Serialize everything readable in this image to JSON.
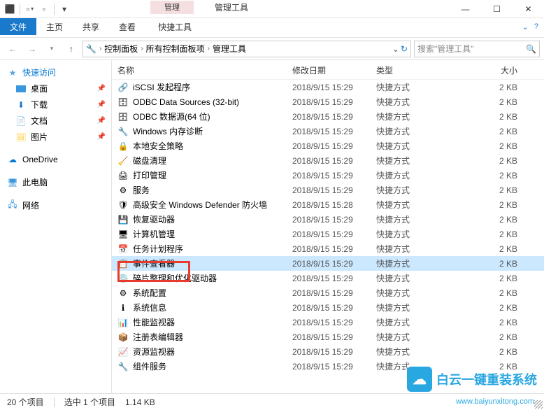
{
  "titlebar": {
    "management": "管理",
    "admin_tools": "管理工具"
  },
  "tabs": {
    "file": "文件",
    "home": "主页",
    "share": "共享",
    "view": "查看",
    "shortcut_tools": "快捷工具"
  },
  "breadcrumb": {
    "control_panel": "控制面板",
    "all_items": "所有控制面板项",
    "admin_tools": "管理工具"
  },
  "search": {
    "placeholder": "搜索\"管理工具\""
  },
  "sidebar": {
    "quick_access": "快速访问",
    "desktop": "桌面",
    "downloads": "下载",
    "documents": "文档",
    "pictures": "图片",
    "onedrive": "OneDrive",
    "this_pc": "此电脑",
    "network": "网络"
  },
  "columns": {
    "name": "名称",
    "modified": "修改日期",
    "type": "类型",
    "size": "大小"
  },
  "files": [
    {
      "name": "iSCSI 发起程序",
      "date": "2018/9/15 15:29",
      "type": "快捷方式",
      "size": "2 KB",
      "icon": "🔗"
    },
    {
      "name": "ODBC Data Sources (32-bit)",
      "date": "2018/9/15 15:29",
      "type": "快捷方式",
      "size": "2 KB",
      "icon": "🗄"
    },
    {
      "name": "ODBC 数据源(64 位)",
      "date": "2018/9/15 15:29",
      "type": "快捷方式",
      "size": "2 KB",
      "icon": "🗄"
    },
    {
      "name": "Windows 内存诊断",
      "date": "2018/9/15 15:29",
      "type": "快捷方式",
      "size": "2 KB",
      "icon": "🔧"
    },
    {
      "name": "本地安全策略",
      "date": "2018/9/15 15:29",
      "type": "快捷方式",
      "size": "2 KB",
      "icon": "🔒"
    },
    {
      "name": "磁盘清理",
      "date": "2018/9/15 15:29",
      "type": "快捷方式",
      "size": "2 KB",
      "icon": "🧹"
    },
    {
      "name": "打印管理",
      "date": "2018/9/15 15:29",
      "type": "快捷方式",
      "size": "2 KB",
      "icon": "🖨"
    },
    {
      "name": "服务",
      "date": "2018/9/15 15:29",
      "type": "快捷方式",
      "size": "2 KB",
      "icon": "⚙"
    },
    {
      "name": "高级安全 Windows Defender 防火墙",
      "date": "2018/9/15 15:28",
      "type": "快捷方式",
      "size": "2 KB",
      "icon": "🛡"
    },
    {
      "name": "恢复驱动器",
      "date": "2018/9/15 15:29",
      "type": "快捷方式",
      "size": "2 KB",
      "icon": "💾"
    },
    {
      "name": "计算机管理",
      "date": "2018/9/15 15:29",
      "type": "快捷方式",
      "size": "2 KB",
      "icon": "🖥"
    },
    {
      "name": "任务计划程序",
      "date": "2018/9/15 15:29",
      "type": "快捷方式",
      "size": "2 KB",
      "icon": "📅"
    },
    {
      "name": "事件查看器",
      "date": "2018/9/15 15:29",
      "type": "快捷方式",
      "size": "2 KB",
      "icon": "📋",
      "selected": true
    },
    {
      "name": "碎片整理和优化驱动器",
      "date": "2018/9/15 15:29",
      "type": "快捷方式",
      "size": "2 KB",
      "icon": "💿"
    },
    {
      "name": "系统配置",
      "date": "2018/9/15 15:29",
      "type": "快捷方式",
      "size": "2 KB",
      "icon": "⚙"
    },
    {
      "name": "系统信息",
      "date": "2018/9/15 15:29",
      "type": "快捷方式",
      "size": "2 KB",
      "icon": "ℹ"
    },
    {
      "name": "性能监视器",
      "date": "2018/9/15 15:29",
      "type": "快捷方式",
      "size": "2 KB",
      "icon": "📊"
    },
    {
      "name": "注册表编辑器",
      "date": "2018/9/15 15:29",
      "type": "快捷方式",
      "size": "2 KB",
      "icon": "📦"
    },
    {
      "name": "资源监视器",
      "date": "2018/9/15 15:29",
      "type": "快捷方式",
      "size": "2 KB",
      "icon": "📈"
    },
    {
      "name": "组件服务",
      "date": "2018/9/15 15:29",
      "type": "快捷方式",
      "size": "2 KB",
      "icon": "🔧"
    }
  ],
  "status": {
    "count": "20 个项目",
    "selected": "选中 1 个项目",
    "size": "1.14 KB"
  },
  "watermark": {
    "text": "白云一键重装系统",
    "url": "www.baiyunxitong.com"
  }
}
